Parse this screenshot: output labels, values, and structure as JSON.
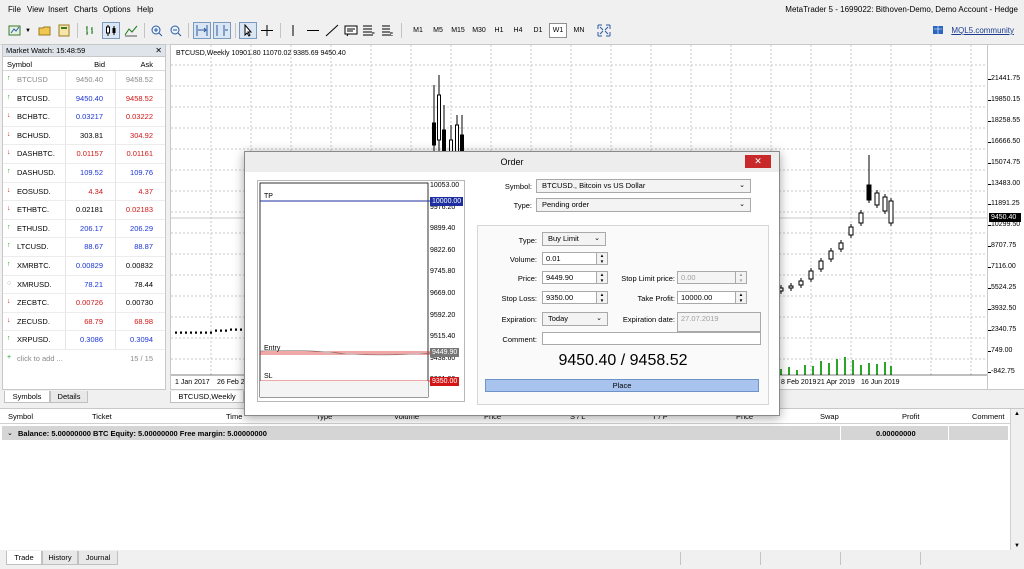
{
  "window": {
    "title": "MetaTrader 5 - 1699022: Bithoven-Demo, Demo Account - Hedge"
  },
  "menu": [
    "File",
    "View",
    "Insert",
    "Charts",
    "Options",
    "Help"
  ],
  "toolbar": {
    "timeframes": [
      "M1",
      "M5",
      "M15",
      "M30",
      "H1",
      "H4",
      "D1",
      "W1",
      "MN"
    ],
    "active_timeframe": "W1",
    "community_link": "MQL5.community"
  },
  "market_watch": {
    "header": "Market Watch: 15:48:59",
    "columns": {
      "symbol": "Symbol",
      "bid": "Bid",
      "ask": "Ask"
    },
    "rows": [
      {
        "symbol": "BTCUSD",
        "bid": "9450.40",
        "ask": "9458.52",
        "dir": "up",
        "bid_color": "gray",
        "ask_color": "gray",
        "sym_color": "gray"
      },
      {
        "symbol": "BTCUSD.",
        "bid": "9450.40",
        "ask": "9458.52",
        "dir": "up",
        "bid_color": "blue",
        "ask_color": "red"
      },
      {
        "symbol": "BCHBTC.",
        "bid": "0.03217",
        "ask": "0.03222",
        "dir": "dn",
        "bid_color": "blue",
        "ask_color": "red"
      },
      {
        "symbol": "BCHUSD.",
        "bid": "303.81",
        "ask": "304.92",
        "dir": "dn",
        "bid_color": "blk",
        "ask_color": "red"
      },
      {
        "symbol": "DASHBTC.",
        "bid": "0.01157",
        "ask": "0.01161",
        "dir": "dn",
        "bid_color": "red",
        "ask_color": "red"
      },
      {
        "symbol": "DASHUSD.",
        "bid": "109.52",
        "ask": "109.76",
        "dir": "up",
        "bid_color": "blue",
        "ask_color": "blue"
      },
      {
        "symbol": "EOSUSD.",
        "bid": "4.34",
        "ask": "4.37",
        "dir": "dn",
        "bid_color": "red",
        "ask_color": "red"
      },
      {
        "symbol": "ETHBTC.",
        "bid": "0.02181",
        "ask": "0.02183",
        "dir": "dn",
        "bid_color": "blk",
        "ask_color": "red"
      },
      {
        "symbol": "ETHUSD.",
        "bid": "206.17",
        "ask": "206.29",
        "dir": "up",
        "bid_color": "blue",
        "ask_color": "blue"
      },
      {
        "symbol": "LTCUSD.",
        "bid": "88.67",
        "ask": "88.87",
        "dir": "up",
        "bid_color": "blue",
        "ask_color": "blue"
      },
      {
        "symbol": "XMRBTC.",
        "bid": "0.00829",
        "ask": "0.00832",
        "dir": "up",
        "bid_color": "blue",
        "ask_color": "blk"
      },
      {
        "symbol": "XMRUSD.",
        "bid": "78.21",
        "ask": "78.44",
        "dir": "neu",
        "bid_color": "blue",
        "ask_color": "blk"
      },
      {
        "symbol": "ZECBTC.",
        "bid": "0.00726",
        "ask": "0.00730",
        "dir": "dn",
        "bid_color": "red",
        "ask_color": "blk"
      },
      {
        "symbol": "ZECUSD.",
        "bid": "68.79",
        "ask": "68.98",
        "dir": "dn",
        "bid_color": "red",
        "ask_color": "red"
      },
      {
        "symbol": "XRPUSD.",
        "bid": "0.3086",
        "ask": "0.3094",
        "dir": "up",
        "bid_color": "blue",
        "ask_color": "blue"
      }
    ],
    "add_row": "click to add ...",
    "count": "15 / 15",
    "tabs": [
      "Symbols",
      "Details"
    ]
  },
  "chart": {
    "title": "BTCUSD,Weekly  10901.80 11070.02 9385.69 9450.40",
    "tab": "BTCUSD,Weekly",
    "price_scale": [
      "21441.75",
      "19850.15",
      "18258.55",
      "16666.50",
      "15074.75",
      "13483.00",
      "11891.25",
      "10299.50",
      "8707.75",
      "7116.00",
      "5524.25",
      "3932.50",
      "2340.75",
      "749.00",
      "-842.75"
    ],
    "current_price": "9450.40",
    "dates": [
      "1 Jan 2017",
      "26 Feb 2",
      "8 Feb 2019",
      "21 Apr 2019",
      "16 Jun 2019"
    ]
  },
  "terminal": {
    "columns": [
      "Symbol",
      "Ticket",
      "Time",
      "Type",
      "Volume",
      "Price",
      "S / L",
      "T / P",
      "Price",
      "Swap",
      "Profit",
      "Comment"
    ],
    "balance_text": "Balance: 5.00000000 BTC  Equity: 5.00000000  Free margin: 5.00000000",
    "profit": "0.00000000",
    "tabs": [
      "Trade",
      "History",
      "Journal"
    ]
  },
  "order": {
    "title": "Order",
    "close": "✕",
    "symbol_label": "Symbol:",
    "symbol_value": "BTCUSD., Bitcoin vs US Dollar",
    "type_label": "Type:",
    "type_value": "Pending order",
    "pending_type_label": "Type:",
    "pending_type_value": "Buy Limit",
    "volume_label": "Volume:",
    "volume_value": "0.01",
    "price_label": "Price:",
    "price_value": "9449.90",
    "stop_limit_label": "Stop Limit price:",
    "stop_limit_value": "0.00",
    "stop_loss_label": "Stop Loss:",
    "stop_loss_value": "9350.00",
    "take_profit_label": "Take Profit:",
    "take_profit_value": "10000.00",
    "expiration_label": "Expiration:",
    "expiration_value": "Today",
    "expiration_date_label": "Expiration date:",
    "expiration_date_value": "27.07.2019",
    "comment_label": "Comment:",
    "comment_value": "",
    "quote": "9450.40 / 9458.52",
    "place_label": "Place",
    "mini_chart": {
      "prices": [
        "10053.00",
        "9976.20",
        "9899.40",
        "9822.60",
        "9745.80",
        "9669.00",
        "9592.20",
        "9515.40",
        "9438.60",
        "9361.80"
      ],
      "tp_label": "TP",
      "tp_tag": "10000.00",
      "entry_label": "Entry",
      "entry_tag": "9449.90",
      "sl_label": "SL",
      "sl_tag": "9350.00"
    }
  }
}
